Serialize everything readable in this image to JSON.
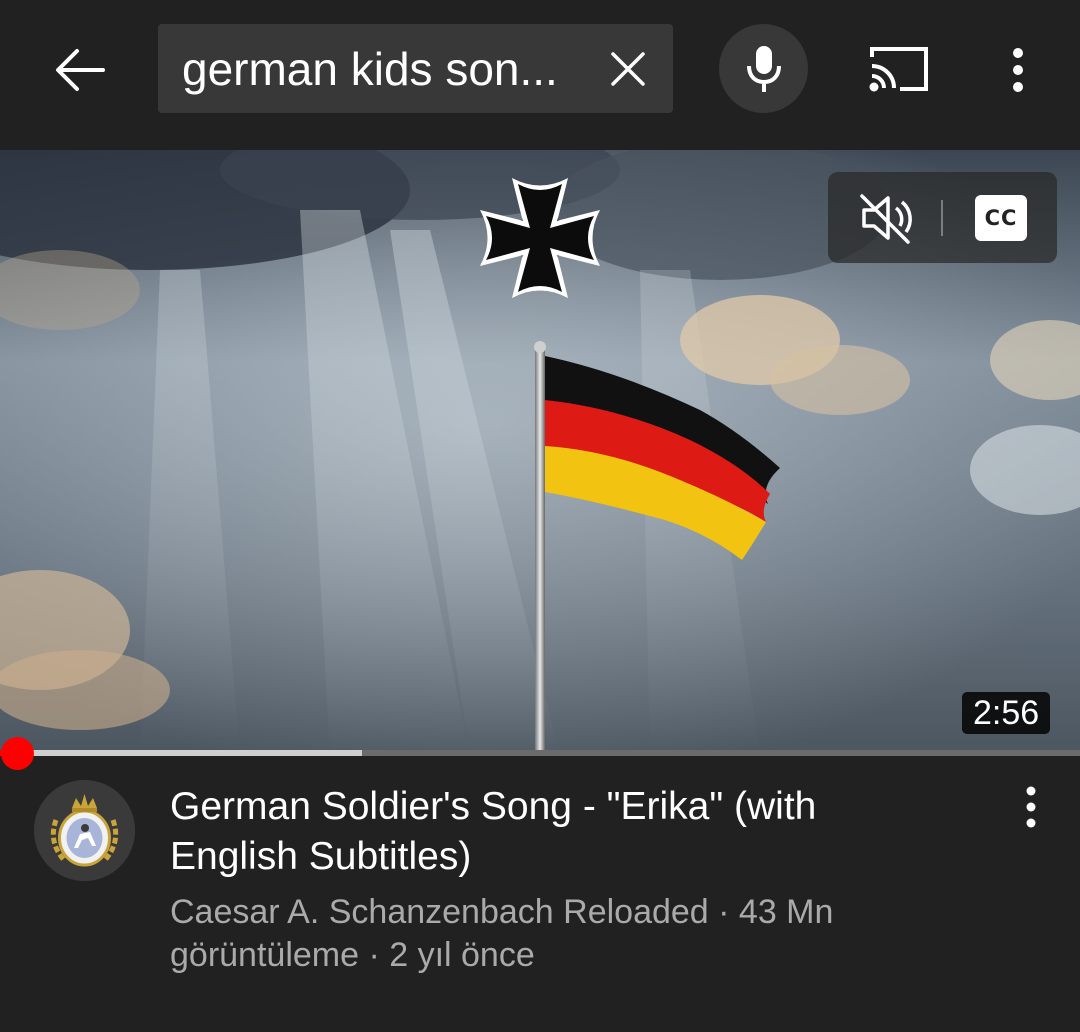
{
  "search": {
    "query": "german kids son..."
  },
  "icons": {
    "back": "back-arrow-icon",
    "clear": "close-icon",
    "mic": "microphone-icon",
    "cast": "cast-icon",
    "more": "more-vertical-icon",
    "mute": "volume-muted-icon",
    "captions": "closed-captions-icon"
  },
  "player": {
    "cc_label": "CC",
    "duration": "2:56",
    "progress_fraction": 0.016,
    "buffered_fraction": 0.335
  },
  "video": {
    "title": "German Soldier's Song - \"Erika\" (with English Subtitles)",
    "meta_line": "Caesar A. Schanzenbach Reloaded · 43 Mn görüntüleme · 2 yıl önce"
  },
  "colors": {
    "background": "#212121",
    "search_field": "#383838",
    "progress_red": "#ff0000",
    "secondary_text": "#aaaaaa"
  }
}
